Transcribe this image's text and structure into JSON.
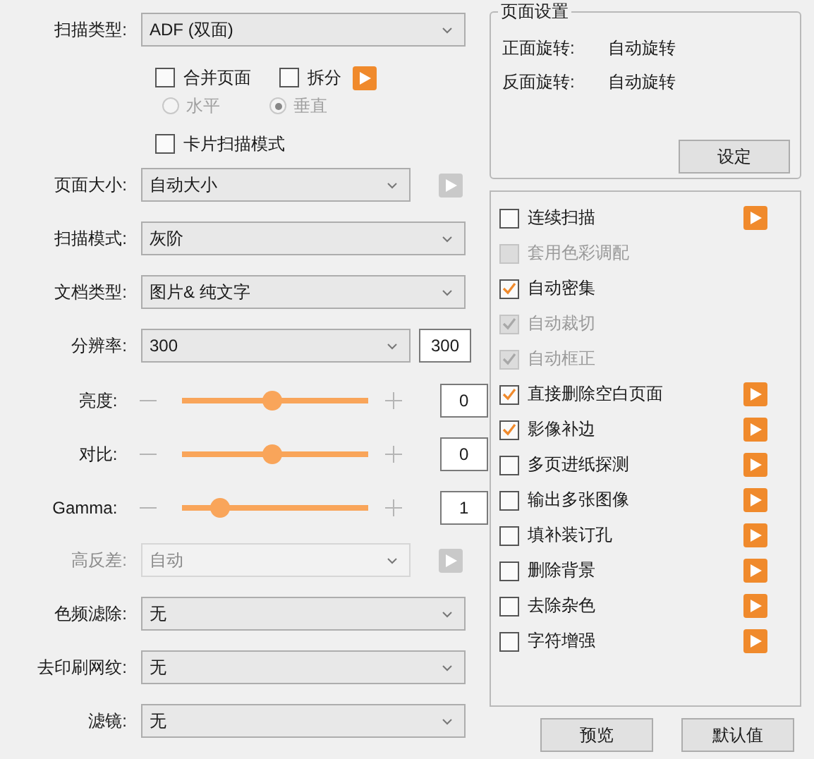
{
  "settings": [
    {
      "kind": "select",
      "label": "扫描类型:",
      "value": "ADF (双面)"
    },
    {
      "kind": "checkboxes",
      "items": [
        {
          "label": "合并页面",
          "checked": false
        },
        {
          "label": "拆分",
          "checked": false
        }
      ],
      "play": {
        "disabled": false
      }
    },
    {
      "kind": "radios",
      "disabled": true,
      "items": [
        {
          "label": "水平",
          "selected": false
        },
        {
          "label": "垂直",
          "selected": true
        }
      ]
    },
    {
      "kind": "checkbox",
      "label": "卡片扫描模式",
      "checked": false
    },
    {
      "kind": "select",
      "label": "页面大小:",
      "value": "自动大小",
      "play": {
        "disabled": true
      }
    },
    {
      "kind": "select",
      "label": "扫描模式:",
      "value": "灰阶"
    },
    {
      "kind": "select",
      "label": "文档类型:",
      "value": "图片& 纯文字"
    },
    {
      "kind": "select",
      "label": "分辨率:",
      "value": "300",
      "input": "300"
    },
    {
      "kind": "slider",
      "label": "亮度:",
      "level": 0.48,
      "input": "0"
    },
    {
      "kind": "slider",
      "label": "对比:",
      "level": 0.48,
      "input": "0"
    },
    {
      "kind": "slider",
      "label": "Gamma:",
      "level": 0.2,
      "input": "1"
    },
    {
      "kind": "select",
      "label": "高反差:",
      "value": "自动",
      "disabled": true,
      "play": {
        "disabled": true
      }
    },
    {
      "kind": "select",
      "label": "色频滤除:",
      "value": "无"
    },
    {
      "kind": "select",
      "label": "去印刷网纹:",
      "value": "无"
    },
    {
      "kind": "select",
      "label": "滤镜:",
      "value": "无"
    }
  ],
  "page_settings": {
    "title": "页面设置",
    "rows": [
      {
        "label": "正面旋转:",
        "value": "自动旋转"
      },
      {
        "label": "反面旋转:",
        "value": "自动旋转"
      }
    ],
    "button": "设定"
  },
  "options": [
    {
      "label": "连续扫描",
      "checked": false,
      "disabled": false,
      "play": {
        "disabled": false
      }
    },
    {
      "label": "套用色彩调配",
      "checked": false,
      "disabled": true
    },
    {
      "label": "自动密集",
      "checked": true,
      "disabled": false
    },
    {
      "label": "自动裁切",
      "checked": true,
      "disabled": true
    },
    {
      "label": "自动框正",
      "checked": true,
      "disabled": true
    },
    {
      "label": "直接删除空白页面",
      "checked": true,
      "disabled": false,
      "play": {
        "disabled": false
      }
    },
    {
      "label": "影像补边",
      "checked": true,
      "disabled": false,
      "play": {
        "disabled": false
      }
    },
    {
      "label": "多页进纸探测",
      "checked": false,
      "disabled": false,
      "play": {
        "disabled": false
      }
    },
    {
      "label": "输出多张图像",
      "checked": false,
      "disabled": false,
      "play": {
        "disabled": false
      }
    },
    {
      "label": "填补装订孔",
      "checked": false,
      "disabled": false,
      "play": {
        "disabled": false
      }
    },
    {
      "label": "删除背景",
      "checked": false,
      "disabled": false,
      "play": {
        "disabled": false
      }
    },
    {
      "label": "去除杂色",
      "checked": false,
      "disabled": false,
      "play": {
        "disabled": false
      }
    },
    {
      "label": "字符增强",
      "checked": false,
      "disabled": false,
      "play": {
        "disabled": false
      }
    }
  ],
  "buttons": [
    "预览",
    "默认值"
  ]
}
